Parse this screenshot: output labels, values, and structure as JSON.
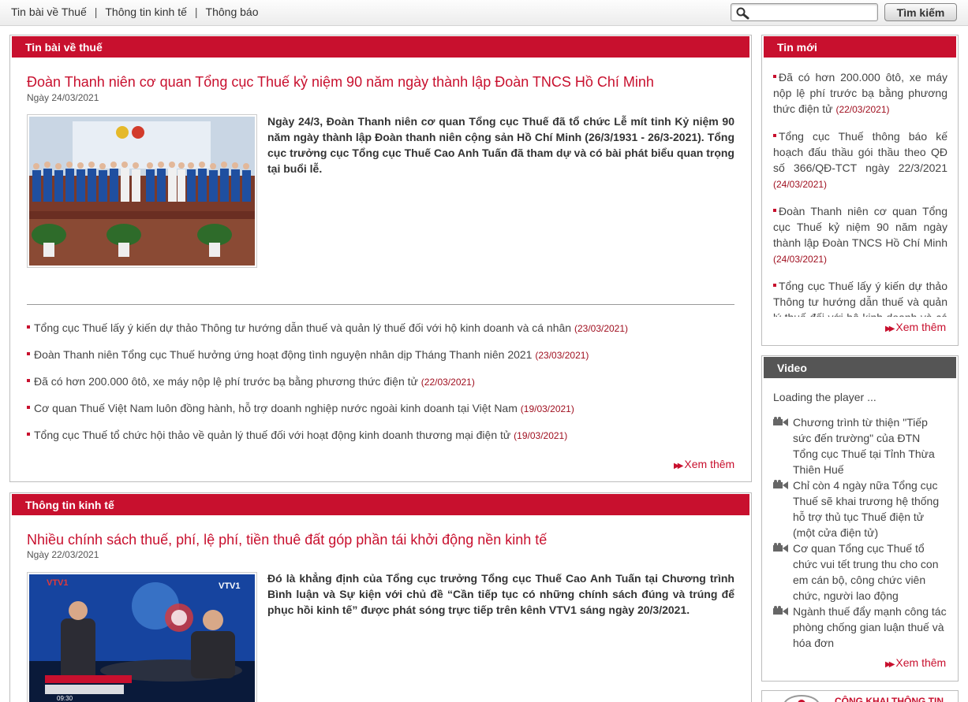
{
  "topnav": {
    "items": [
      "Tin bài về Thuế",
      "Thông tin kinh tế",
      "Thông báo"
    ],
    "separator": "|"
  },
  "search": {
    "placeholder": "",
    "value": "",
    "button_label": "Tìm kiếm",
    "icon": "search-icon"
  },
  "tax_news": {
    "header": "Tin bài về thuế",
    "headline": {
      "title": "Đoàn Thanh niên cơ quan Tổng cục Thuế kỷ niệm 90 năm ngày thành lập Đoàn TNCS Hồ Chí Minh",
      "date": "Ngày 24/03/2021",
      "summary": "Ngày 24/3, Đoàn Thanh niên cơ quan Tổng cục Thuế đã tổ chức Lễ mít tinh Kỷ niệm 90 năm ngày thành lập Đoàn thanh niên cộng sản Hồ Chí Minh (26/3/1931 - 26/3-2021). Tổng cục trưởng cục Tổng cục Thuế Cao Anh Tuấn đã tham dự và có bài phát biểu quan trọng tại buổi lễ."
    },
    "related": [
      {
        "title": "Tổng cục Thuế lấy ý kiến dự thảo Thông tư hướng dẫn thuế và quản lý thuế đối với hộ kinh doanh và cá nhân",
        "date": "(23/03/2021)"
      },
      {
        "title": "Đoàn Thanh niên Tổng cục Thuế hưởng ứng hoạt động tình nguyện nhân dịp Tháng Thanh niên 2021",
        "date": "(23/03/2021)"
      },
      {
        "title": "Đã có hơn 200.000 ôtô, xe máy nộp lệ phí trước bạ bằng phương thức điện tử",
        "date": "(22/03/2021)"
      },
      {
        "title": "Cơ quan Thuế Việt Nam luôn đồng hành, hỗ trợ doanh nghiệp nước ngoài kinh doanh tại Việt Nam",
        "date": "(19/03/2021)"
      },
      {
        "title": "Tổng cục Thuế tổ chức hội thảo về quản lý thuế đối với hoạt động kinh doanh thương mại điện tử",
        "date": "(19/03/2021)"
      }
    ],
    "more": "Xem thêm"
  },
  "economic_news": {
    "header": "Thông tin kinh tế",
    "headline": {
      "title": "Nhiều chính sách thuế, phí, lệ phí, tiền thuê đất góp phần tái khởi động nền kinh tế",
      "date": "Ngày 22/03/2021",
      "summary": "Đó là khẳng định của Tổng cục trưởng Tổng cục Thuế Cao Anh Tuấn tại Chương trình Bình luận và Sự kiện với chủ đề “Cần tiếp tục có những chính sách đúng và trúng để phục hồi kinh tế” được phát sóng trực tiếp trên kênh VTV1 sáng ngày 20/3/2021.",
      "image_overlay": {
        "logo": "VTV1",
        "time": "09:30"
      }
    }
  },
  "latest_news": {
    "header": "Tin mới",
    "items": [
      {
        "title": "Đã có hơn 200.000 ôtô, xe máy nộp lệ phí trước bạ bằng phương thức điện tử",
        "date": "(22/03/2021)"
      },
      {
        "title": "Tổng cục Thuế thông báo kế hoạch đấu thầu gói thầu theo QĐ số 366/QĐ-TCT ngày 22/3/2021",
        "date": "(24/03/2021)"
      },
      {
        "title": "Đoàn Thanh niên cơ quan Tổng cục Thuế kỷ niệm 90 năm ngày thành lập Đoàn TNCS Hồ Chí Minh",
        "date": "(24/03/2021)"
      },
      {
        "title": "Tổng cục Thuế lấy ý kiến dự thảo Thông tư hướng dẫn thuế và quản lý thuế đối với hộ kinh doanh và cá nhân",
        "date": ""
      }
    ],
    "more": "Xem thêm"
  },
  "video": {
    "header": "Video",
    "loading": "Loading the player ...",
    "items": [
      "Chương trình từ thiện \"Tiếp sức đến trường\" của ĐTN Tổng cục Thuế tại Tỉnh Thừa Thiên Huế",
      "Chỉ còn 4 ngày nữa Tổng cục Thuế sẽ khai trương hệ thống hỗ trợ thủ tục Thuế điện tử (một cửa điện tử)",
      "Cơ quan Tổng cục Thuế tổ chức vui tết trung thu cho con em cán bộ, công chức viên chức, người lao động",
      "Ngành thuế đẩy mạnh công tác phòng chống gian luận thuế và hóa đơn"
    ],
    "more": "Xem thêm"
  },
  "public_banner": {
    "text": "CÔNG KHAI THÔNG TIN"
  },
  "colors": {
    "accent": "#c8102e",
    "video_header": "#555555",
    "date": "#a01020"
  }
}
